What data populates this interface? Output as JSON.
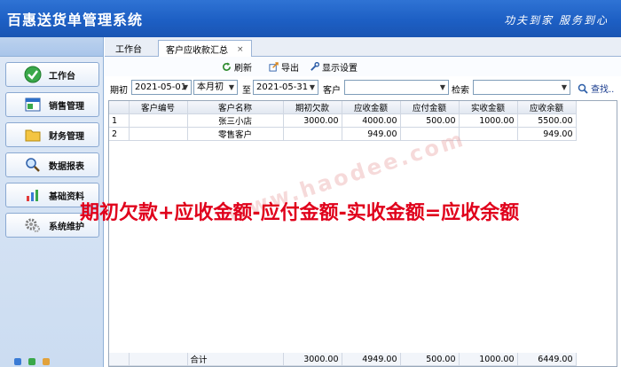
{
  "app": {
    "title": "百惠送货单管理系统",
    "slogan": "功夫到家 服务到心"
  },
  "sidebar": {
    "items": [
      {
        "label": "工作台",
        "icon": "check-circle-icon"
      },
      {
        "label": "销售管理",
        "icon": "window-icon"
      },
      {
        "label": "财务管理",
        "icon": "folder-icon"
      },
      {
        "label": "数据报表",
        "icon": "magnifier-icon"
      },
      {
        "label": "基础资料",
        "icon": "chart-icon"
      },
      {
        "label": "系统维护",
        "icon": "gears-icon"
      }
    ]
  },
  "tabs": [
    {
      "label": "工作台"
    },
    {
      "label": "客户应收款汇总",
      "close": "×"
    }
  ],
  "toolbar": {
    "refresh": "刷新",
    "export": "导出",
    "display_settings": "显示设置"
  },
  "filter": {
    "period_label": "期初",
    "start_date": "2021-05-01",
    "period_select": "本月初",
    "to_label": "至",
    "end_date": "2021-05-31",
    "customer_label": "客户",
    "customer_value": "",
    "search_label": "检索",
    "search_value": "",
    "find_label": "查找.."
  },
  "table": {
    "columns": [
      "",
      "客户编号",
      "客户名称",
      "期初欠款",
      "应收金额",
      "应付金额",
      "实收金额",
      "应收余额"
    ],
    "rows": [
      [
        "1",
        "",
        "张三小店",
        "3000.00",
        "4000.00",
        "500.00",
        "1000.00",
        "5500.00"
      ],
      [
        "2",
        "",
        "零售客户",
        "",
        "949.00",
        "",
        "",
        "949.00"
      ]
    ],
    "summary": [
      "",
      "",
      "合计",
      "3000.00",
      "4949.00",
      "500.00",
      "1000.00",
      "6449.00"
    ]
  },
  "overlay": {
    "watermark": "www.haodee.com",
    "formula": "期初欠款+应收金额-应付金额-实收金额=应收余额"
  },
  "colors": {
    "titlebar": "#1d5fc4",
    "formula": "#e0001b",
    "sidebar": "#d4e2f4"
  }
}
